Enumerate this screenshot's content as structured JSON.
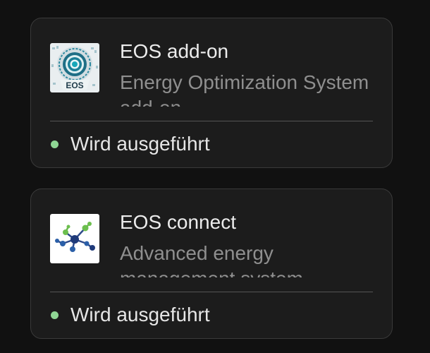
{
  "addons": [
    {
      "name": "EOS add-on",
      "description": "Energy Optimization System add-on",
      "status": "Wird ausgeführt",
      "icon": "eos-logo-icon",
      "icon_text": "EOS",
      "status_color": "#8fd694"
    },
    {
      "name": "EOS connect",
      "description": "Advanced energy management system",
      "status": "Wird ausgeführt",
      "icon": "network-graph-icon",
      "status_color": "#8fd694"
    }
  ]
}
